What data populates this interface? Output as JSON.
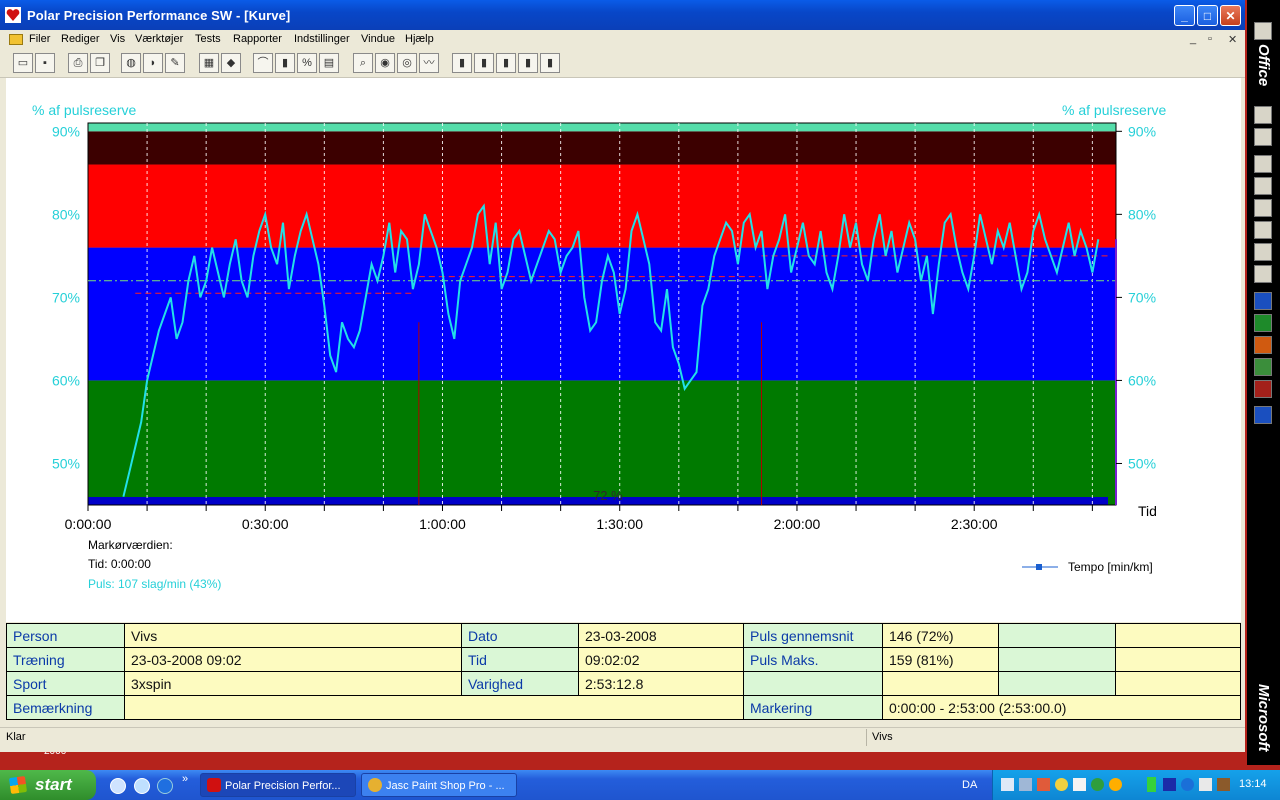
{
  "window": {
    "title": "Polar Precision Performance SW - [Kurve]"
  },
  "menu": [
    "Filer",
    "Rediger",
    "Vis",
    "Værktøjer",
    "Tests",
    "Rapporter",
    "Indstillinger",
    "Vindue",
    "Hjælp"
  ],
  "chart_data": {
    "type": "line",
    "title": "",
    "ylabel_left": "% af pulsreserve",
    "ylabel_right": "% af pulsreserve",
    "xlabel": "Tid",
    "ylim": [
      45,
      91
    ],
    "xlim_seconds": [
      0,
      10440
    ],
    "y_ticks": [
      "50%",
      "60%",
      "70%",
      "80%",
      "90%"
    ],
    "x_ticks": [
      "0:00:00",
      "0:30:00",
      "1:00:00",
      "1:30:00",
      "2:00:00",
      "2:30:00"
    ],
    "zones": [
      {
        "from": 45,
        "to": 60,
        "color": "#007a00"
      },
      {
        "from": 60,
        "to": 76,
        "color": "#0000ff"
      },
      {
        "from": 76,
        "to": 86,
        "color": "#ff0000"
      },
      {
        "from": 86,
        "to": 90,
        "color": "#3c0000"
      },
      {
        "from": 90,
        "to": 91,
        "color": "#55ddaa"
      }
    ],
    "average_line": 72,
    "average_label": "72 %",
    "series": [
      {
        "name": "Puls",
        "x_minutes": [
          6,
          7,
          8,
          9,
          10,
          11,
          12,
          13,
          14,
          15,
          16,
          17,
          18,
          19,
          20,
          21,
          22,
          23,
          24,
          25,
          26,
          27,
          28,
          29,
          30,
          31,
          32,
          33,
          34,
          35,
          36,
          37,
          38,
          39,
          40,
          41,
          42,
          43,
          44,
          45,
          46,
          47,
          48,
          49,
          50,
          51,
          52,
          53,
          54,
          55,
          56,
          57,
          58,
          59,
          60,
          61,
          62,
          63,
          64,
          65,
          66,
          67,
          68,
          69,
          70,
          71,
          72,
          73,
          74,
          75,
          76,
          77,
          78,
          79,
          80,
          81,
          82,
          83,
          84,
          85,
          86,
          87,
          88,
          89,
          90,
          91,
          92,
          93,
          94,
          95,
          96,
          97,
          98,
          99,
          100,
          101,
          102,
          103,
          104,
          105,
          106,
          107,
          108,
          109,
          110,
          111,
          112,
          113,
          114,
          115,
          116,
          117,
          118,
          119,
          120,
          121,
          122,
          123,
          124,
          125,
          126,
          127,
          128,
          129,
          130,
          131,
          132,
          133,
          134,
          135,
          136,
          137,
          138,
          139,
          140,
          141,
          142,
          143,
          144,
          145,
          146,
          147,
          148,
          149,
          150,
          151,
          152,
          153,
          154,
          155,
          156,
          157,
          158,
          159,
          160,
          161,
          162,
          163,
          164,
          165,
          166,
          167,
          168,
          169,
          170,
          171,
          172,
          173
        ],
        "values": [
          46,
          49,
          52,
          55,
          60,
          63,
          66,
          68,
          70,
          65,
          67,
          72,
          75,
          70,
          72,
          76,
          73,
          70,
          74,
          77,
          72,
          70,
          75,
          78,
          80,
          76,
          74,
          79,
          71,
          75,
          78,
          80,
          77,
          74,
          69,
          63,
          61,
          67,
          65,
          64,
          66,
          70,
          74,
          72,
          75,
          79,
          73,
          78,
          77,
          71,
          74,
          80,
          78,
          76,
          73,
          68,
          65,
          72,
          74,
          76,
          80,
          81,
          74,
          79,
          71,
          73,
          77,
          78,
          75,
          72,
          74,
          76,
          78,
          77,
          73,
          75,
          76,
          78,
          70,
          66,
          67,
          72,
          75,
          73,
          68,
          71,
          78,
          80,
          77,
          74,
          67,
          66,
          71,
          64,
          62,
          59,
          60,
          61,
          69,
          71,
          75,
          77,
          79,
          78,
          74,
          79,
          80,
          76,
          78,
          71,
          75,
          77,
          80,
          73,
          76,
          79,
          75,
          74,
          78,
          73,
          71,
          75,
          80,
          76,
          79,
          74,
          72,
          77,
          80,
          75,
          78,
          73,
          76,
          79,
          77,
          72,
          75,
          68,
          74,
          79,
          80,
          76,
          73,
          71,
          75,
          80,
          77,
          74,
          78,
          76,
          79,
          75,
          71,
          73,
          78,
          80,
          77,
          75,
          73,
          76,
          79,
          75,
          78,
          76,
          73,
          77
        ]
      }
    ]
  },
  "marker_info": {
    "heading": "Markørværdien:",
    "tid": "Tid: 0:00:00",
    "puls": "Puls: 107 slag/min (43%)"
  },
  "legend": {
    "tempo": "Tempo [min/km]"
  },
  "info_table": [
    [
      "Person",
      "Vivs",
      "Dato",
      "23-03-2008",
      "Puls gennemsnit",
      "146 (72%)",
      "",
      ""
    ],
    [
      "Træning",
      "23-03-2008 09:02",
      "Tid",
      "09:02:02",
      "Puls Maks.",
      "159 (81%)",
      "",
      ""
    ],
    [
      "Sport",
      "3xspin",
      "Varighed",
      "2:53:12.8",
      "",
      "",
      "",
      ""
    ],
    [
      "Bemærkning",
      "",
      "",
      "",
      "Markering",
      "0:00:00 - 2:53:00 (2:53:00.0)",
      "",
      ""
    ]
  ],
  "status": {
    "left": "Klar",
    "right": "Vivs"
  },
  "officebar": {
    "top": "Office",
    "bottom": "Microsoft"
  },
  "taskbar": {
    "start": "start",
    "task1": "Polar Precision Perfor...",
    "task2": "Jasc Paint Shop Pro - ...",
    "lang": "DA",
    "clock": "13:14"
  },
  "desktop": {
    "label": "2006"
  },
  "colors": {
    "accent_cyan": "#26d0d8",
    "heart_line": "#22e0e8"
  }
}
